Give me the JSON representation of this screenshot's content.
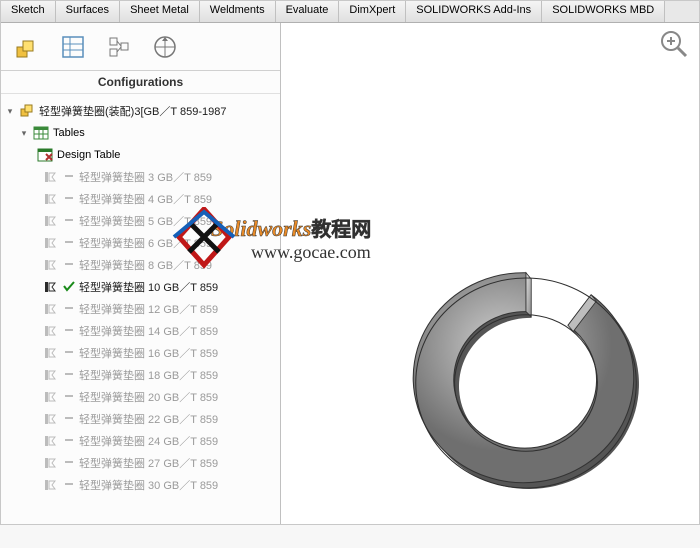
{
  "tabs": [
    "Sketch",
    "Surfaces",
    "Sheet Metal",
    "Weldments",
    "Evaluate",
    "DimXpert",
    "SOLIDWORKS Add-Ins",
    "SOLIDWORKS MBD"
  ],
  "panel": {
    "title": "Configurations",
    "root": "轻型弹簧垫圈(装配)3[GB／T 859-1987",
    "tablesLabel": "Tables",
    "designTable": "Design Table"
  },
  "configs": [
    {
      "label": "轻型弹簧垫圈 3 GB／T 859",
      "active": false
    },
    {
      "label": "轻型弹簧垫圈 4 GB／T 859",
      "active": false
    },
    {
      "label": "轻型弹簧垫圈 5 GB／T 859",
      "active": false
    },
    {
      "label": "轻型弹簧垫圈 6 GB／T 859",
      "active": false
    },
    {
      "label": "轻型弹簧垫圈 8 GB／T 859",
      "active": false
    },
    {
      "label": "轻型弹簧垫圈 10 GB／T 859",
      "active": true
    },
    {
      "label": "轻型弹簧垫圈 12 GB／T 859",
      "active": false
    },
    {
      "label": "轻型弹簧垫圈 14 GB／T 859",
      "active": false
    },
    {
      "label": "轻型弹簧垫圈 16 GB／T 859",
      "active": false
    },
    {
      "label": "轻型弹簧垫圈 18 GB／T 859",
      "active": false
    },
    {
      "label": "轻型弹簧垫圈 20 GB／T 859",
      "active": false
    },
    {
      "label": "轻型弹簧垫圈 22 GB／T 859",
      "active": false
    },
    {
      "label": "轻型弹簧垫圈 24 GB／T 859",
      "active": false
    },
    {
      "label": "轻型弹簧垫圈 27 GB／T 859",
      "active": false
    },
    {
      "label": "轻型弹簧垫圈 30 GB／T 859",
      "active": false
    }
  ],
  "watermark": {
    "line1a": "Solidworks",
    "line1b": "教程网",
    "line2": "www.gocae.com"
  }
}
